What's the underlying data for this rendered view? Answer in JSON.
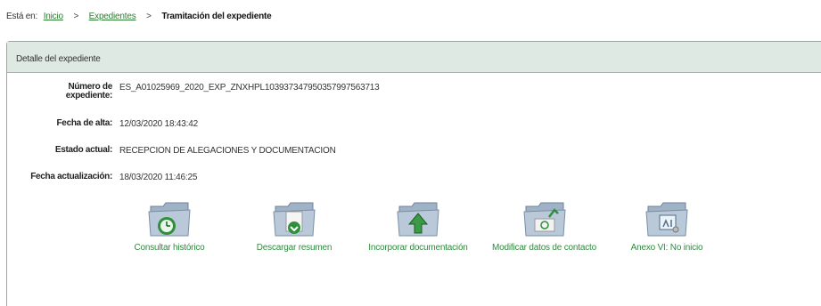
{
  "breadcrumb": {
    "prefix": "Está en:",
    "items": [
      "Inicio",
      "Expedientes"
    ],
    "current": "Tramitación del expediente",
    "separator": ">"
  },
  "panel": {
    "title": "Detalle del expediente"
  },
  "fields": {
    "numero_label_line1": "Número de",
    "numero_label_line2": "expediente:",
    "numero_value": "ES_A01025969_2020_EXP_ZNXHPL1039373479503579975637​13",
    "fecha_alta_label": "Fecha de alta:",
    "fecha_alta_value": "12/03/2020 18:43:42",
    "estado_label": "Estado actual:",
    "estado_value": "RECEPCION DE ALEGACIONES Y DOCUMENTACION",
    "fecha_act_label": "Fecha actualización:",
    "fecha_act_value": "18/03/2020 11:46:25"
  },
  "actions": [
    {
      "label": "Consultar histórico",
      "icon": "folder-clock-icon"
    },
    {
      "label": "Descargar resumen",
      "icon": "folder-download-icon"
    },
    {
      "label": "Incorporar documentación",
      "icon": "folder-upload-icon"
    },
    {
      "label": "Modificar datos de contacto",
      "icon": "folder-email-icon"
    },
    {
      "label": "Anexo VI: No inicio",
      "icon": "folder-document-icon"
    }
  ],
  "colors": {
    "link": "#2e7d32",
    "header_bg": "#dfe9e4",
    "folder": "#8fa3b8"
  }
}
